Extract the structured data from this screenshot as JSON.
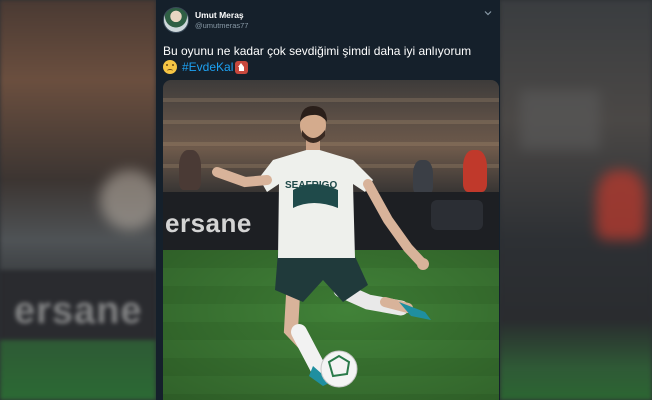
{
  "tweet": {
    "author_name": "Umut Meraş",
    "author_handle": "@umutmeras77",
    "text": "Bu oyunu ne kadar çok sevdiğimi şimdi daha iyi anlıyorum",
    "hashtag": "#EvdeKal"
  },
  "photo": {
    "board_text": "ersane",
    "shirt_text": "SEAFRIGO"
  },
  "icons": {
    "menu": "chevron-down-icon",
    "emoji_1": "sad-face-emoji-icon",
    "emoji_2": "house-emoji-icon"
  },
  "colors": {
    "card_bg": "#15202b",
    "link": "#1da1f2",
    "handle": "#8899a6"
  }
}
